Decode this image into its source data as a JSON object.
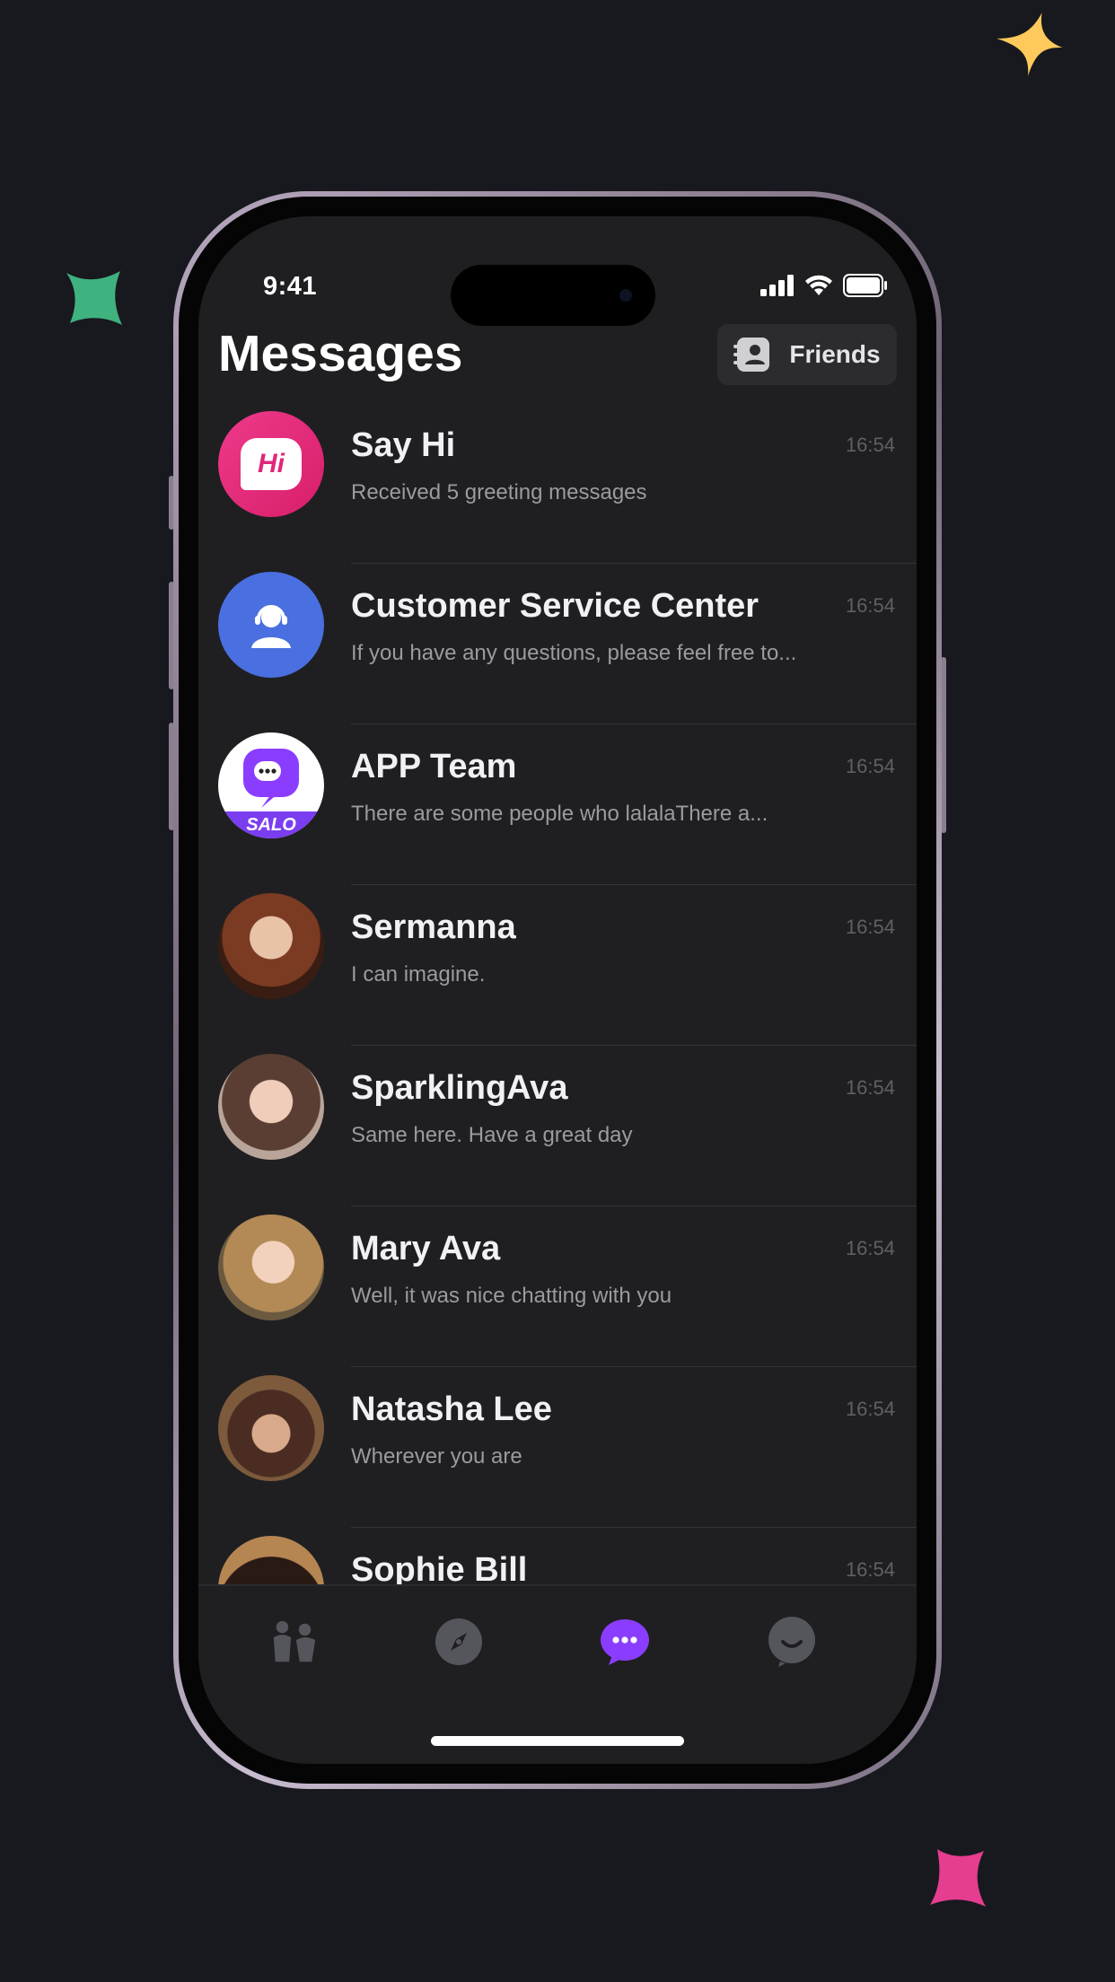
{
  "status_bar": {
    "time": "9:41"
  },
  "header": {
    "title": "Messages",
    "friends_label": "Friends"
  },
  "conversations": [
    {
      "name": "Say Hi",
      "preview": "Received 5 greeting messages",
      "time": "16:54",
      "avatar": "say-hi-icon",
      "avatar_text": "Hi"
    },
    {
      "name": "Customer Service Center",
      "preview": "If you have any questions, please feel free to...",
      "time": "16:54",
      "avatar": "headset-icon"
    },
    {
      "name": "APP Team",
      "preview": "There are some people who lalalaThere a...",
      "time": "16:54",
      "avatar": "salo-logo",
      "avatar_text": "SALO"
    },
    {
      "name": "Sermanna",
      "preview": " I can imagine.",
      "time": "16:54",
      "avatar": "user-photo"
    },
    {
      "name": "SparklingAva",
      "preview": "Same here. Have a great day",
      "time": "16:54",
      "avatar": "user-photo"
    },
    {
      "name": "Mary Ava",
      "preview": "Well, it was nice chatting with you",
      "time": "16:54",
      "avatar": "user-photo"
    },
    {
      "name": "Natasha Lee",
      "preview": "Wherever you are",
      "time": "16:54",
      "avatar": "user-photo"
    },
    {
      "name": "Sophie Bill",
      "preview": "",
      "time": "16:54",
      "avatar": "user-photo"
    }
  ],
  "tabs": [
    {
      "name": "people",
      "icon": "people-icon",
      "active": false
    },
    {
      "name": "discover",
      "icon": "compass-icon",
      "active": false
    },
    {
      "name": "messages",
      "icon": "chat-bubble-icon",
      "active": true
    },
    {
      "name": "profile",
      "icon": "profile-face-icon",
      "active": false
    }
  ],
  "colors": {
    "background": "#18191e",
    "screen": "#1f1f22",
    "accent": "#8b3dff",
    "say_hi": "#e0267a",
    "customer_service": "#4a6fe0",
    "sparkle_yellow": "#ffc95c",
    "sparkle_green": "#3fb27f",
    "sparkle_pink": "#e53d8f"
  }
}
